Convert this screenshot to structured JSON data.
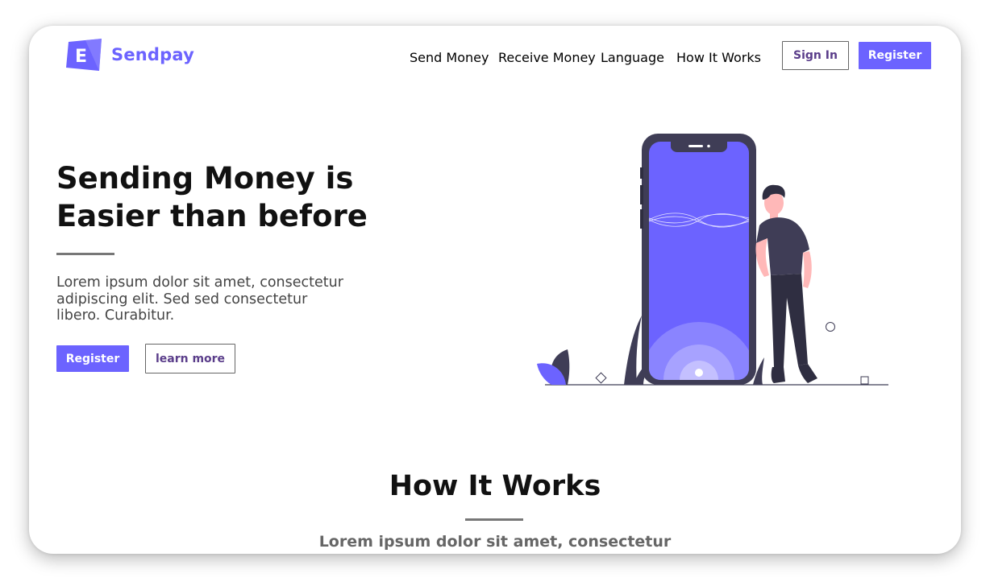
{
  "brand": {
    "name": "Sendpay",
    "logo_letter": "E",
    "color": "#6c63ff"
  },
  "nav": {
    "items": [
      {
        "label": "Send Money"
      },
      {
        "label": "Receive Money"
      },
      {
        "label": "Language"
      },
      {
        "label": "How It Works"
      }
    ],
    "sign_in_label": "Sign In",
    "register_label": "Register"
  },
  "hero": {
    "title_line1": "Sending Money is",
    "title_line2": "Easier than before",
    "description": "Lorem ipsum dolor sit amet, consectetur adipiscing elit. Sed sed consectetur libero. Curabitur.",
    "register_label": "Register",
    "learn_more_label": "learn more",
    "illustration_icon": "person-with-phone-illustration"
  },
  "how_it_works": {
    "title": "How It Works",
    "subtitle": "Lorem ipsum dolor sit amet, consectetur"
  }
}
